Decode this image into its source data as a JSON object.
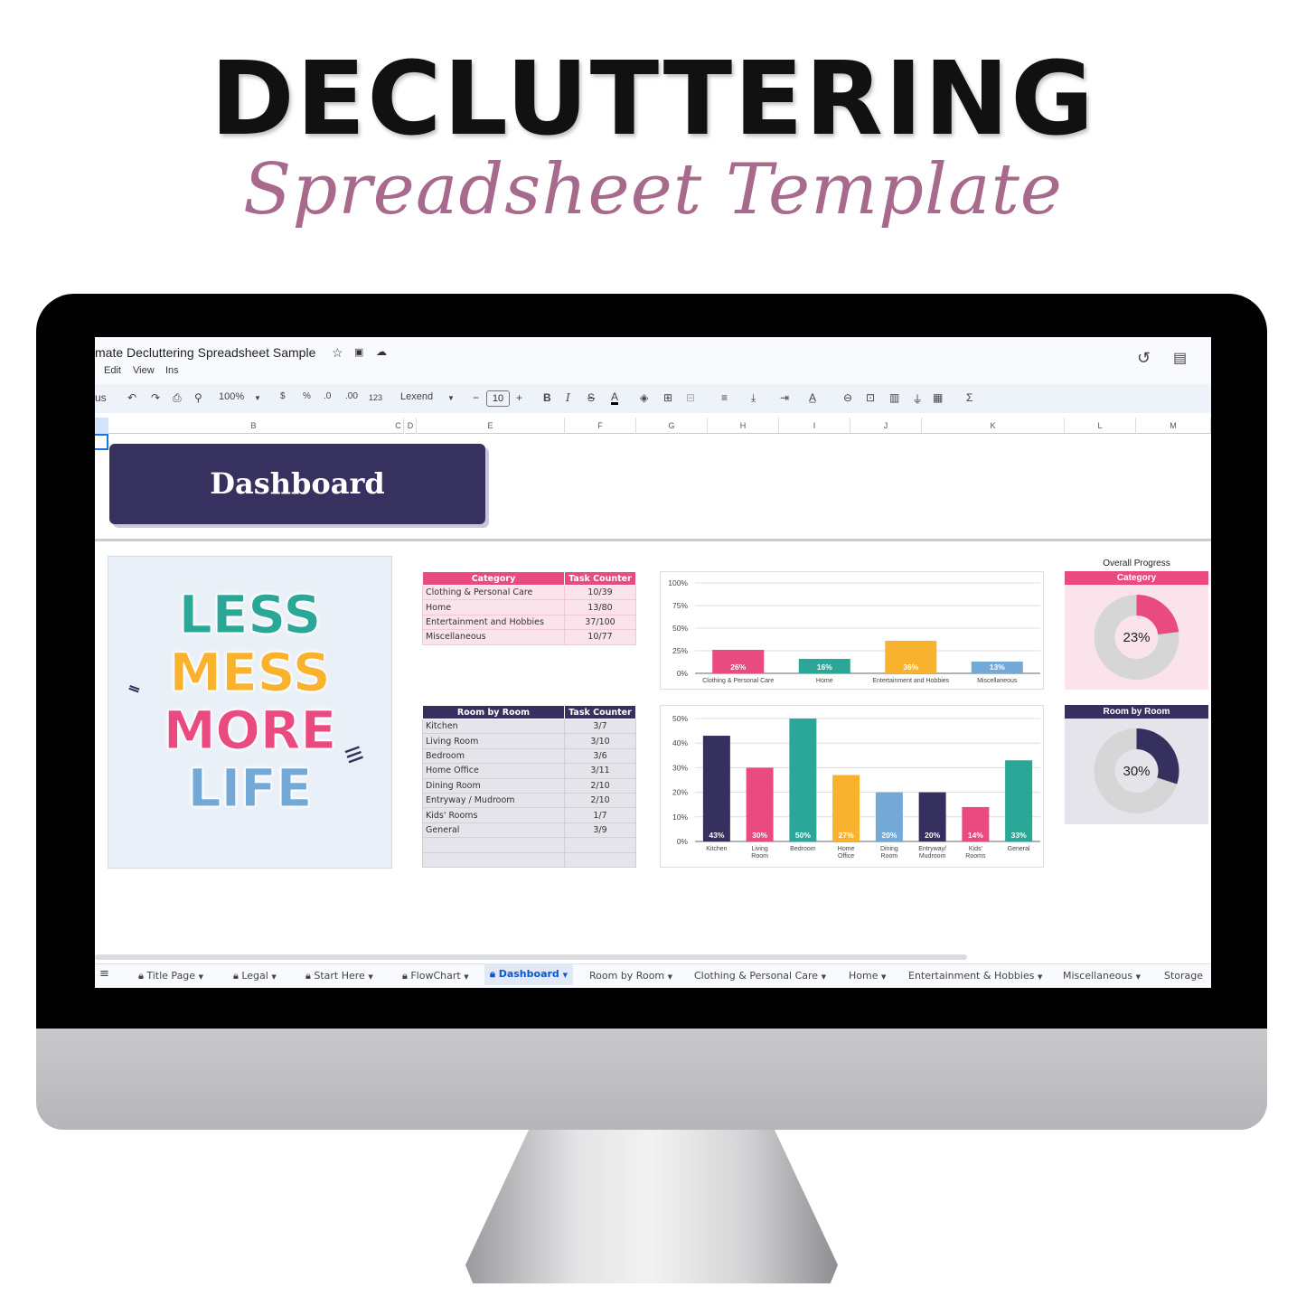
{
  "hero": {
    "title": "DECLUTTERING",
    "subtitle": "Spreadsheet Template"
  },
  "doc": {
    "title": "mate Decluttering Spreadsheet Sample",
    "menu": [
      "Edit",
      "View",
      "Ins"
    ]
  },
  "toolbar": {
    "search_stub": "us",
    "zoom": "100%",
    "currency": "$",
    "percent": "%",
    "dec_less": ".0",
    "dec_more": ".00",
    "format": "123",
    "font": "Lexend",
    "font_size": "10"
  },
  "columns": [
    "B",
    "C",
    "D",
    "E",
    "F",
    "G",
    "H",
    "I",
    "J",
    "K",
    "L",
    "M"
  ],
  "dashboard": {
    "label": "Dashboard"
  },
  "poster": {
    "lines": [
      "LESS",
      "MESS",
      "MORE",
      "LIFE"
    ]
  },
  "category_table": {
    "headers": [
      "Category",
      "Task Counter"
    ],
    "rows": [
      [
        "Clothing & Personal Care",
        "10/39"
      ],
      [
        "Home",
        "13/80"
      ],
      [
        "Entertainment and Hobbies",
        "37/100"
      ],
      [
        "Miscellaneous",
        "10/77"
      ]
    ]
  },
  "room_table": {
    "headers": [
      "Room by Room",
      "Task Counter"
    ],
    "rows": [
      [
        "Kitchen",
        "3/7"
      ],
      [
        "Living Room",
        "3/10"
      ],
      [
        "Bedroom",
        "3/6"
      ],
      [
        "Home Office",
        "3/11"
      ],
      [
        "Dining Room",
        "2/10"
      ],
      [
        "Entryway / Mudroom",
        "2/10"
      ],
      [
        "Kids' Rooms",
        "1/7"
      ],
      [
        "General",
        "3/9"
      ]
    ]
  },
  "overall": {
    "label": "Overall Progress",
    "category": {
      "title": "Category",
      "value": 23,
      "label": "23%",
      "color": "#e94a7f",
      "bg": "#fbe3ec"
    },
    "room": {
      "title": "Room by Room",
      "value": 30,
      "label": "30%",
      "color": "#36305e",
      "bg": "#e4e4ea"
    }
  },
  "chart_data": [
    {
      "type": "bar",
      "categories": [
        "Clothing & Personal Care",
        "Home",
        "Entertainment and Hobbies",
        "Miscellaneous"
      ],
      "values": [
        26,
        16,
        36,
        13
      ],
      "data_labels": [
        "26%",
        "16%",
        "36%",
        "13%"
      ],
      "colors": [
        "#e94a7f",
        "#2aa796",
        "#f8b22e",
        "#74a9d6"
      ],
      "ylim": [
        0,
        100
      ],
      "yticks": [
        "0%",
        "25%",
        "50%",
        "75%",
        "100%"
      ],
      "grid": true
    },
    {
      "type": "bar",
      "categories": [
        "Kitchen",
        "Living Room",
        "Bedroom",
        "Home Office",
        "Dining Room",
        "Entryway / Mudroom",
        "Kids' Rooms",
        "General"
      ],
      "values": [
        43,
        30,
        50,
        27,
        20,
        20,
        14,
        33
      ],
      "data_labels": [
        "43%",
        "30%",
        "50%",
        "27%",
        "20%",
        "20%",
        "14%",
        "33%"
      ],
      "colors": [
        "#36305e",
        "#e94a7f",
        "#2aa796",
        "#f8b22e",
        "#74a9d6",
        "#36305e",
        "#e94a7f",
        "#2aa796"
      ],
      "ylim": [
        0,
        50
      ],
      "yticks": [
        "0%",
        "10%",
        "20%",
        "30%",
        "40%",
        "50%"
      ],
      "grid": true
    }
  ],
  "sheet_tabs": [
    {
      "label": "Title Page",
      "locked": true
    },
    {
      "label": "Legal",
      "locked": true
    },
    {
      "label": "Start Here",
      "locked": true
    },
    {
      "label": "FlowChart",
      "locked": true
    },
    {
      "label": "Dashboard",
      "locked": true,
      "active": true
    },
    {
      "label": "Room by Room"
    },
    {
      "label": "Clothing & Personal Care"
    },
    {
      "label": "Home"
    },
    {
      "label": "Entertainment & Hobbies"
    },
    {
      "label": "Miscellaneous"
    },
    {
      "label": "Storage"
    }
  ]
}
